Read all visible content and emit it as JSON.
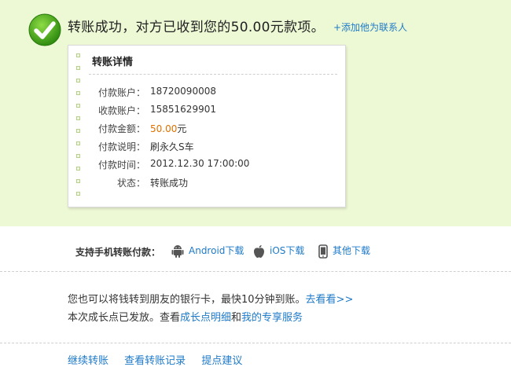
{
  "success": {
    "message": "转账成功，对方已收到您的50.00元款项。",
    "add_contact": "+添加他为联系人"
  },
  "details": {
    "title": "转账详情",
    "rows": [
      {
        "label": "付款账户：",
        "value": "18720090008"
      },
      {
        "label": "收款账户：",
        "value": "15851629901"
      },
      {
        "label": "付款金额：",
        "amount": "50.00",
        "unit": "元"
      },
      {
        "label": "付款说明：",
        "value": "刷永久S车"
      },
      {
        "label": "付款时间：",
        "value": "2012.12.30 17:00:00"
      },
      {
        "label": "状态：",
        "value": "转账成功"
      }
    ]
  },
  "download": {
    "label": "支持手机转账付款：",
    "android": "Android下载",
    "ios": "iOS下载",
    "other": "其他下载"
  },
  "info": {
    "line1_text": "您也可以将钱转到朋友的银行卡，最快10分钟到账。",
    "line1_link": "去看看>>",
    "line2_prefix": "本次成长点已发放。查看",
    "line2_link1": "成长点明细",
    "line2_and": "和",
    "line2_link2": "我的专享服务"
  },
  "bottom": {
    "continue": "继续转账",
    "records": "查看转账记录",
    "feedback": "提点建议"
  },
  "colors": {
    "panel_bg": "#edf8d5",
    "link": "#1e7ac8",
    "amount": "#e07000",
    "success_green": "#3e9b16"
  }
}
